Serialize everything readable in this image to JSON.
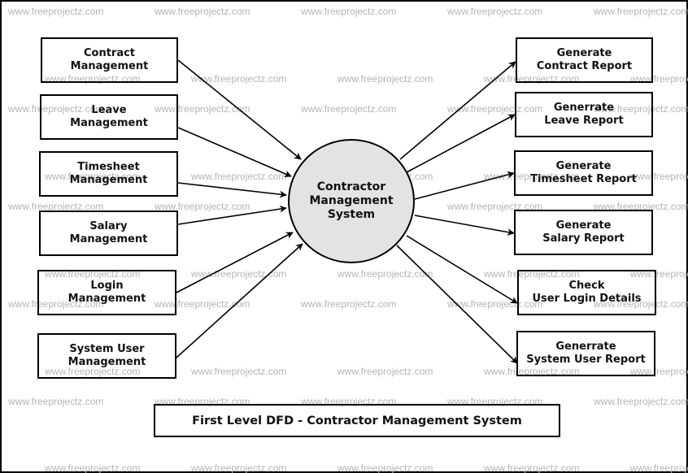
{
  "diagram": {
    "type": "data-flow-diagram",
    "title": "First Level DFD - Contractor Management System",
    "central_process": "Contractor\nManagement\nSystem",
    "inputs": [
      "Contract\nManagement",
      "Leave\nManagement",
      "Timesheet\nManagement",
      "Salary\nManagement",
      "Login\nManagement",
      "System User\nManagement"
    ],
    "outputs": [
      "Generate\nContract Report",
      "Generrate\nLeave Report",
      "Generate\nTimesheet Report",
      "Generate\nSalary Report",
      "Check\nUser Login Details",
      "Generrate\nSystem User Report"
    ],
    "flows": [
      {
        "from": "Contract Management",
        "to": "Contractor Management System"
      },
      {
        "from": "Leave Management",
        "to": "Contractor Management System"
      },
      {
        "from": "Timesheet Management",
        "to": "Contractor Management System"
      },
      {
        "from": "Salary Management",
        "to": "Contractor Management System"
      },
      {
        "from": "Login Management",
        "to": "Contractor Management System"
      },
      {
        "from": "System User Management",
        "to": "Contractor Management System"
      },
      {
        "from": "Contractor Management System",
        "to": "Generate Contract Report"
      },
      {
        "from": "Contractor Management System",
        "to": "Generrate Leave Report"
      },
      {
        "from": "Contractor Management System",
        "to": "Generate Timesheet Report"
      },
      {
        "from": "Contractor Management System",
        "to": "Generate Salary Report"
      },
      {
        "from": "Contractor Management System",
        "to": "Check User Login Details"
      },
      {
        "from": "Contractor Management System",
        "to": "Generrate System User Report"
      }
    ],
    "watermark": "www.freeprojectz.com",
    "colors": {
      "process_fill": "#e3e3e3",
      "stroke": "#000000",
      "watermark": "#b4b4b4"
    }
  }
}
